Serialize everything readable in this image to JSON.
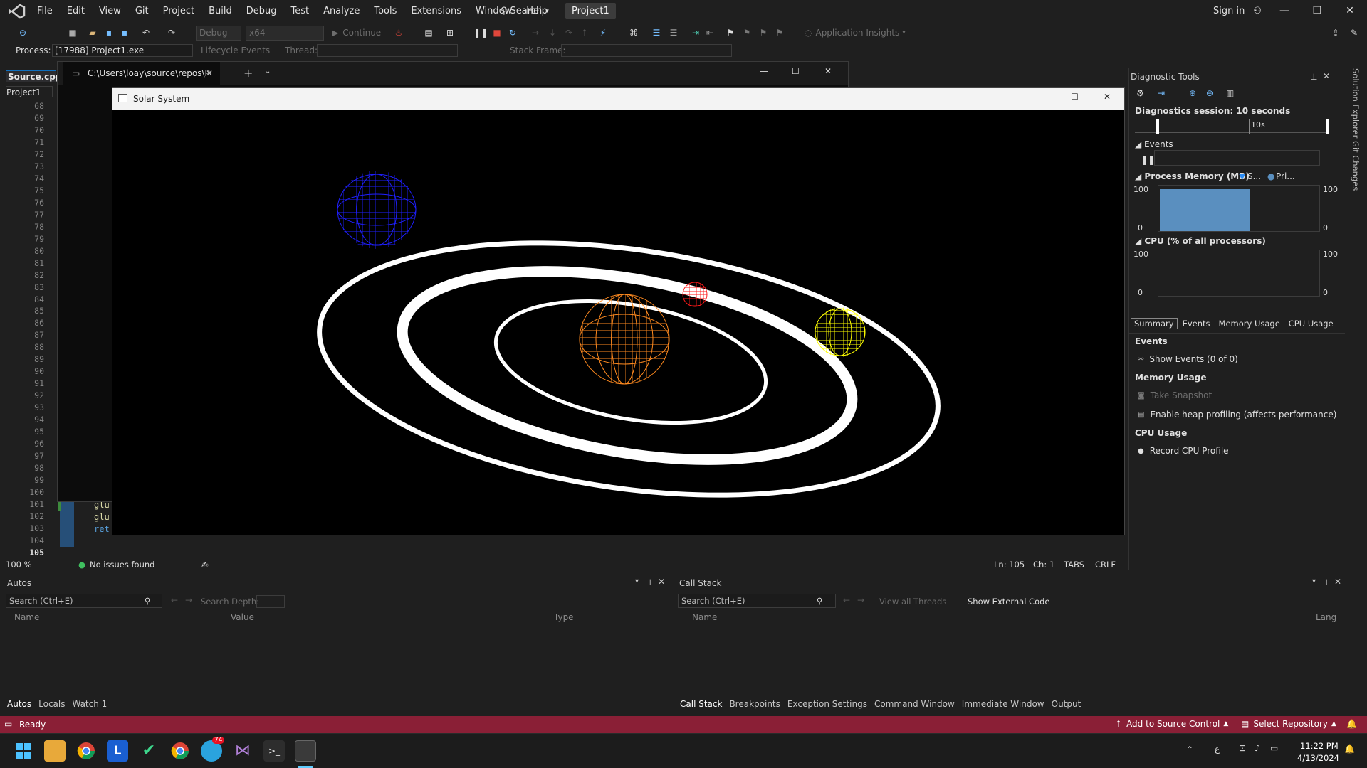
{
  "menubar": {
    "items": [
      "File",
      "Edit",
      "View",
      "Git",
      "Project",
      "Build",
      "Debug",
      "Test",
      "Analyze",
      "Tools",
      "Extensions",
      "Window",
      "Help"
    ],
    "search_label": "Search",
    "project_pill": "Project1",
    "signin": "Sign in"
  },
  "toolbar": {
    "config": "Debug",
    "platform": "x64",
    "continue": "Continue",
    "app_insights": "Application Insights"
  },
  "procbar": {
    "process_label": "Process:",
    "process_value": "[17988] Project1.exe",
    "lifecycle": "Lifecycle Events",
    "thread_label": "Thread:",
    "stackframe_label": "Stack Frame:"
  },
  "editor": {
    "tab": "Source.cpp",
    "project_combo": "Project1",
    "line_numbers": [
      "68",
      "69",
      "70",
      "71",
      "72",
      "73",
      "74",
      "75",
      "76",
      "77",
      "78",
      "79",
      "80",
      "81",
      "82",
      "83",
      "84",
      "85",
      "86",
      "87",
      "88",
      "89",
      "90",
      "91",
      "92",
      "93",
      "94",
      "95",
      "96",
      "97",
      "98",
      "99",
      "100",
      "101",
      "102",
      "103",
      "104",
      "105"
    ],
    "code_peek": [
      "glu",
      "glu",
      "ret"
    ],
    "zoom": "100 %",
    "issues": "No issues found",
    "ln": "Ln: 105",
    "ch": "Ch: 1",
    "tabs": "TABS",
    "crlf": "CRLF"
  },
  "terminal": {
    "tab_title": "C:\\Users\\loay\\source\\repos\\P"
  },
  "solar": {
    "title": "Solar System"
  },
  "diagnostics": {
    "title": "Diagnostic Tools",
    "session": "Diagnostics session: 10 seconds",
    "timeline_tick": "10s",
    "events_label": "Events",
    "memory_label": "Process Memory (MB)",
    "memory_legend_1": "S...",
    "memory_legend_2": "Pri...",
    "cpu_label": "CPU (% of all processors)",
    "axis_max": "100",
    "axis_min": "0",
    "tabs": [
      "Summary",
      "Events",
      "Memory Usage",
      "CPU Usage"
    ],
    "sec_events": "Events",
    "show_events": "Show Events (0 of 0)",
    "sec_memory": "Memory Usage",
    "take_snapshot": "Take Snapshot",
    "heap_profiling": "Enable heap profiling (affects performance)",
    "sec_cpu": "CPU Usage",
    "record_cpu": "Record CPU Profile",
    "side_solution": "Solution Explorer",
    "side_git": "Git Changes",
    "memory_series_level": 0.92,
    "accent": "#5a8fbf"
  },
  "autos": {
    "title": "Autos",
    "search": "Search (Ctrl+E)",
    "search_depth": "Search Depth:",
    "col_name": "Name",
    "col_value": "Value",
    "col_type": "Type",
    "tabs": [
      "Autos",
      "Locals",
      "Watch 1"
    ]
  },
  "callstack": {
    "title": "Call Stack",
    "search": "Search (Ctrl+E)",
    "view_threads": "View all Threads",
    "show_external": "Show External Code",
    "col_name": "Name",
    "col_lang": "Lang",
    "tabs": [
      "Call Stack",
      "Breakpoints",
      "Exception Settings",
      "Command Window",
      "Immediate Window",
      "Output"
    ]
  },
  "statusbar": {
    "ready": "Ready",
    "add_source": "Add to Source Control",
    "select_repo": "Select Repository",
    "color": "#8a1f36"
  },
  "taskbar": {
    "time": "11:22 PM",
    "date": "4/13/2024",
    "badge": "74",
    "lang": "ع"
  }
}
